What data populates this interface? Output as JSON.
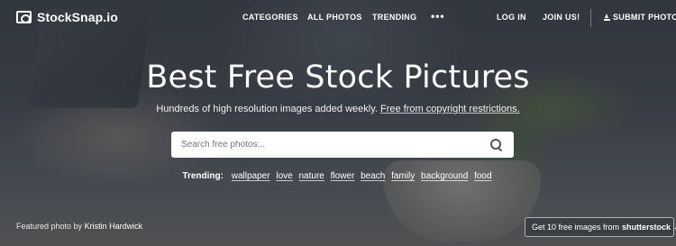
{
  "header": {
    "logo_text": "StockSnap.io",
    "nav": {
      "categories": "CATEGORIES",
      "all_photos": "ALL PHOTOS",
      "trending": "TRENDING",
      "more": "•••",
      "log_in": "LOG IN",
      "join_us": "JOIN US!",
      "submit_photos": "SUBMIT PHOTOS"
    }
  },
  "hero": {
    "title": "Best Free Stock Pictures",
    "subtitle_text": "Hundreds of high resolution images added weekly.",
    "subtitle_link": "Free from copyright restrictions."
  },
  "search": {
    "placeholder": "Search free photos..."
  },
  "trending": {
    "label": "Trending:",
    "tags": [
      "wallpaper",
      "love",
      "nature",
      "flower",
      "beach",
      "family",
      "background",
      "food"
    ]
  },
  "footer": {
    "credit_prefix": "Featured photo by",
    "credit_author": "Kristin Hardwick",
    "promo_text": "Get 10 free images from",
    "promo_brand": "shutterstock"
  }
}
